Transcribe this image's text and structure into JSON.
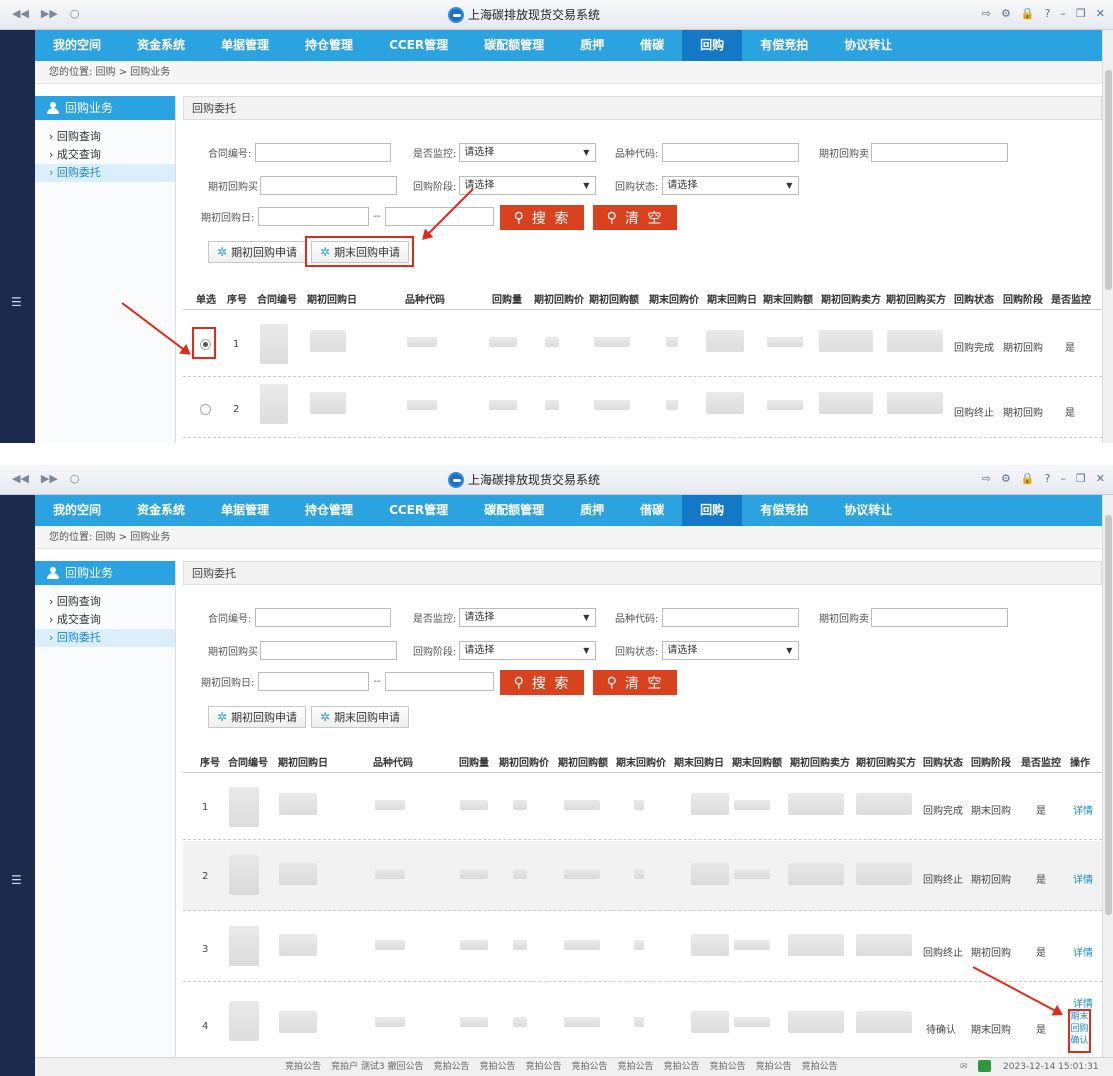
{
  "window": {
    "title": "上海碳排放现货交易系统",
    "left_controls": [
      "◀◀",
      "▶▶",
      "○"
    ],
    "right_controls": [
      "⇨",
      "⚙",
      "🔒",
      "?",
      "–",
      "❐",
      "✕"
    ]
  },
  "nav": {
    "items": [
      "我的空间",
      "资金系统",
      "单据管理",
      "持仓管理",
      "CCER管理",
      "碳配额管理",
      "质押",
      "借碳",
      "回购",
      "有偿竞拍",
      "协议转让"
    ],
    "active": "回购"
  },
  "breadcrumb": "您的位置: 回购 > 回购业务",
  "sidebar": {
    "title": "回购业务",
    "items": [
      "回购查询",
      "成交查询",
      "回购委托"
    ],
    "active": "回购委托"
  },
  "panel": {
    "title": "回购委托"
  },
  "form": {
    "contract_no": "合同编号:",
    "is_monitored": "是否监控:",
    "product_code": "品种代码:",
    "initial_seller": "期初回购卖",
    "initial_buyer": "期初回购买",
    "repo_stage": "回购阶段:",
    "repo_status": "回购状态:",
    "initial_date": "期初回购日:",
    "date_sep": "--",
    "select_placeholder": "请选择",
    "search_btn": "搜 索",
    "clear_btn": "清 空",
    "initial_apply_btn": "期初回购申请",
    "end_apply_btn": "期末回购申请"
  },
  "table1": {
    "headers": [
      "单选",
      "序号",
      "合同编号",
      "期初回购日",
      "品种代码",
      "回购量",
      "期初回购价",
      "期初回购额",
      "期末回购价",
      "期末回购日",
      "期末回购额",
      "期初回购卖方",
      "期初回购买方",
      "回购状态",
      "回购阶段",
      "是否监控"
    ],
    "rows": [
      {
        "no": "1",
        "status": "回购完成",
        "stage": "期初回购",
        "monitored": "是",
        "selected": true
      },
      {
        "no": "2",
        "status": "回购终止",
        "stage": "期初回购",
        "monitored": "是",
        "selected": false
      }
    ]
  },
  "table2": {
    "headers": [
      "序号",
      "合同编号",
      "期初回购日",
      "品种代码",
      "回购量",
      "期初回购价",
      "期初回购额",
      "期末回购价",
      "期末回购日",
      "期末回购额",
      "期初回购卖方",
      "期初回购买方",
      "回购状态",
      "回购阶段",
      "是否监控",
      "操作"
    ],
    "rows": [
      {
        "no": "1",
        "status": "回购完成",
        "stage": "期末回购",
        "monitored": "是",
        "actions": [
          "详情"
        ]
      },
      {
        "no": "2",
        "status": "回购终止",
        "stage": "期初回购",
        "monitored": "是",
        "actions": [
          "详情"
        ]
      },
      {
        "no": "3",
        "status": "回购终止",
        "stage": "期初回购",
        "monitored": "是",
        "actions": [
          "详情"
        ]
      },
      {
        "no": "4",
        "status": "待确认",
        "stage": "期末回购",
        "monitored": "是",
        "actions": [
          "详情",
          "期末",
          "回购",
          "确认"
        ]
      }
    ]
  },
  "statusbar": {
    "items": [
      "竞拍公告",
      "竞拍户 测试3 撤回公告",
      "竞拍公告",
      "竞拍公告",
      "竞拍公告",
      "竞拍公告",
      "竞拍公告",
      "竞拍公告",
      "竞拍公告",
      "竞拍公告",
      "竞拍公告"
    ],
    "datetime": "2023-12-14 15:01:31"
  }
}
